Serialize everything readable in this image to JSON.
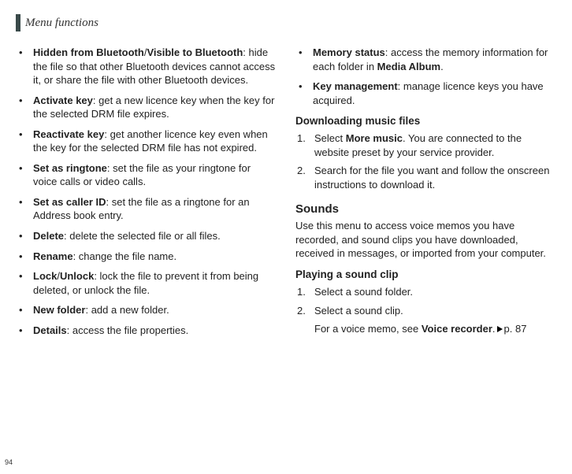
{
  "header": {
    "title": "Menu functions"
  },
  "col1": {
    "b1": {
      "t1": "Hidden from Bluetooth",
      "sep": "/",
      "t2": "Visible to Bluetooth",
      "rest": ": hide the file so that other Bluetooth devices cannot access it, or share the file with other Bluetooth devices."
    },
    "b2": {
      "t": "Activate key",
      "rest": ": get a new licence key when the key for the selected DRM file expires."
    },
    "b3": {
      "t": "Reactivate key",
      "rest": ": get another licence key even when the key for the selected DRM file has not expired."
    },
    "b4": {
      "t": "Set as ringtone",
      "rest": ": set the file as your ringtone for voice calls or video calls."
    },
    "b5": {
      "t": "Set as caller ID",
      "rest": ": set the file as a ringtone for an Address book entry."
    },
    "b6": {
      "t": "Delete",
      "rest": ": delete the selected file or all files."
    },
    "b7": {
      "t": "Rename",
      "rest": ": change the file name."
    },
    "b8": {
      "t1": "Lock",
      "sep": "/",
      "t2": "Unlock",
      "rest": ": lock the file to prevent it from being deleted, or unlock the file."
    },
    "b9": {
      "t": "New folder",
      "rest": ": add a new folder."
    },
    "b10": {
      "t": "Details",
      "rest": ": access the file properties."
    }
  },
  "col2": {
    "b1": {
      "t": "Memory status",
      "rest1": ": access the memory information for each folder in ",
      "bold2": "Media Album",
      "rest2": "."
    },
    "b2": {
      "t": "Key management",
      "rest": ": manage licence keys you have acquired."
    },
    "h1": "Downloading music files",
    "n1": {
      "num": "1.",
      "pre": "Select ",
      "bold": "More music",
      "post": ". You are connected to the website preset by your service provider."
    },
    "n2": {
      "num": "2.",
      "text": "Search for the file you want and follow the onscreen instructions to download it."
    },
    "h2": "Sounds",
    "intro": "Use this menu to access voice memos you have recorded, and sound clips you have downloaded, received in messages, or imported from your computer.",
    "h3": "Playing a sound clip",
    "n3": {
      "num": "1.",
      "text": "Select a sound folder."
    },
    "n4": {
      "num": "2.",
      "text": "Select a sound clip."
    },
    "note": {
      "pre": "For a voice memo, see ",
      "bold": "Voice recorder",
      "post1": ".",
      "ref": "p. 87"
    }
  },
  "pageNumber": "94"
}
